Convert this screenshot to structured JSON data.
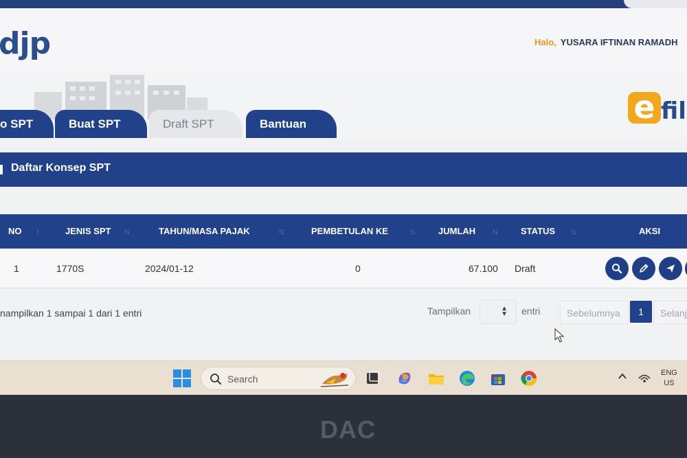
{
  "header": {
    "logo_text": "djp",
    "greeting_label": "Halo,",
    "user_name": "YUSARA IFTINAN RAMADH"
  },
  "brand": {
    "efiling_e": "e",
    "efiling_rest": "fil"
  },
  "tabs": [
    {
      "label": "o SPT"
    },
    {
      "label": "Buat SPT"
    },
    {
      "label": "Draft SPT"
    },
    {
      "label": "Bantuan"
    }
  ],
  "section": {
    "title": "Daftar Konsep SPT"
  },
  "table": {
    "columns": [
      "NO",
      "JENIS SPT",
      "TAHUN/MASA PAJAK",
      "PEMBETULAN KE",
      "JUMLAH",
      "STATUS",
      "AKSI"
    ],
    "rows": [
      {
        "no": "1",
        "jenis_spt": "1770S",
        "tahun_masa": "2024/01-12",
        "pembetulan_ke": "0",
        "jumlah": "67.100",
        "status": "Draft"
      }
    ]
  },
  "footer": {
    "info": "nampilkan 1 sampai 1 dari 1 entri",
    "tampilkan_label": "Tampilkan",
    "entri_label": "entri",
    "prev_label": "Sebelumnya",
    "current_page": "1",
    "next_label": "Selanj"
  },
  "taskbar": {
    "search_placeholder": "Search",
    "lang_line1": "ENG",
    "lang_line2": "US"
  },
  "bezel": {
    "brand": "DAC"
  },
  "colors": {
    "primary_blue": "#22418b",
    "accent_orange": "#f2a81c",
    "greeting_orange": "#e89a1b"
  }
}
